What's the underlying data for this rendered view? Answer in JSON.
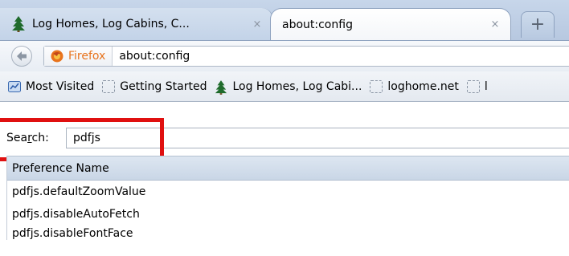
{
  "tabs": [
    {
      "label": "Log Homes, Log Cabins, C...",
      "favicon": "tree-icon",
      "active": false
    },
    {
      "label": "about:config",
      "favicon": "",
      "active": true
    }
  ],
  "new_tab_label": "+",
  "close_glyph": "×",
  "navbar": {
    "identity_label": "Firefox",
    "url": "about:config"
  },
  "bookmarks": [
    {
      "label": "Most Visited",
      "icon": "most-visited-icon"
    },
    {
      "label": "Getting Started",
      "icon": "page-icon"
    },
    {
      "label": "Log Homes, Log Cabi...",
      "icon": "tree-icon"
    },
    {
      "label": "loghome.net",
      "icon": "page-icon"
    },
    {
      "label": "l",
      "icon": "page-icon"
    }
  ],
  "search": {
    "label": "Search:",
    "value": "pdfjs"
  },
  "prefs": {
    "header": "Preference Name",
    "rows": [
      "pdfjs.defaultZoomValue",
      "pdfjs.disableAutoFetch",
      "pdfjs.disableFontFace"
    ]
  },
  "colors": {
    "highlight": "#e01010",
    "firefox_orange": "#e8731c"
  }
}
